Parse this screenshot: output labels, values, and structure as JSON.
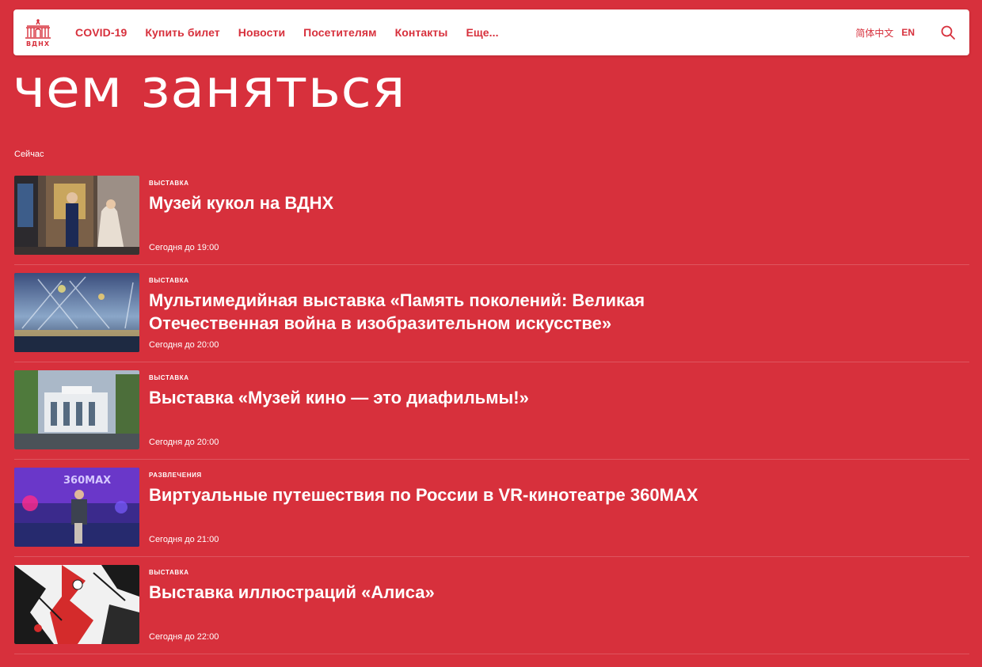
{
  "header": {
    "logo_icon": "vdnh-arch-icon",
    "logo_text": "ВДНХ",
    "nav": [
      "COVID-19",
      "Купить билет",
      "Новости",
      "Посетителям",
      "Контакты",
      "Еще..."
    ],
    "lang_zh": "简体中文",
    "lang_en": "EN",
    "search_icon": "search-icon"
  },
  "page": {
    "title": "чем заняться",
    "section_label": "Сейчас"
  },
  "events": [
    {
      "category": "ВЫСТАВКА",
      "title": "Музей кукол на ВДНХ",
      "time": "Сегодня до 19:00"
    },
    {
      "category": "ВЫСТАВКА",
      "title": "Мультимедийная выставка «Память поколений: Великая Отечественная война в изобразительном искусстве»",
      "time": "Сегодня до 20:00"
    },
    {
      "category": "ВЫСТАВКА",
      "title": "Выставка «Музей кино — это диафильмы!»",
      "time": "Сегодня до 20:00"
    },
    {
      "category": "РАЗВЛЕЧЕНИЯ",
      "title": "Виртуальные путешествия по России в VR-кинотеатре 360MAX",
      "time": "Сегодня до 21:00"
    },
    {
      "category": "ВЫСТАВКА",
      "title": "Выставка иллюстраций «Алиса»",
      "time": "Сегодня до 22:00"
    }
  ],
  "thumb_sign": "360MAX",
  "colors": {
    "brand_red": "#d7303c",
    "white": "#ffffff"
  }
}
